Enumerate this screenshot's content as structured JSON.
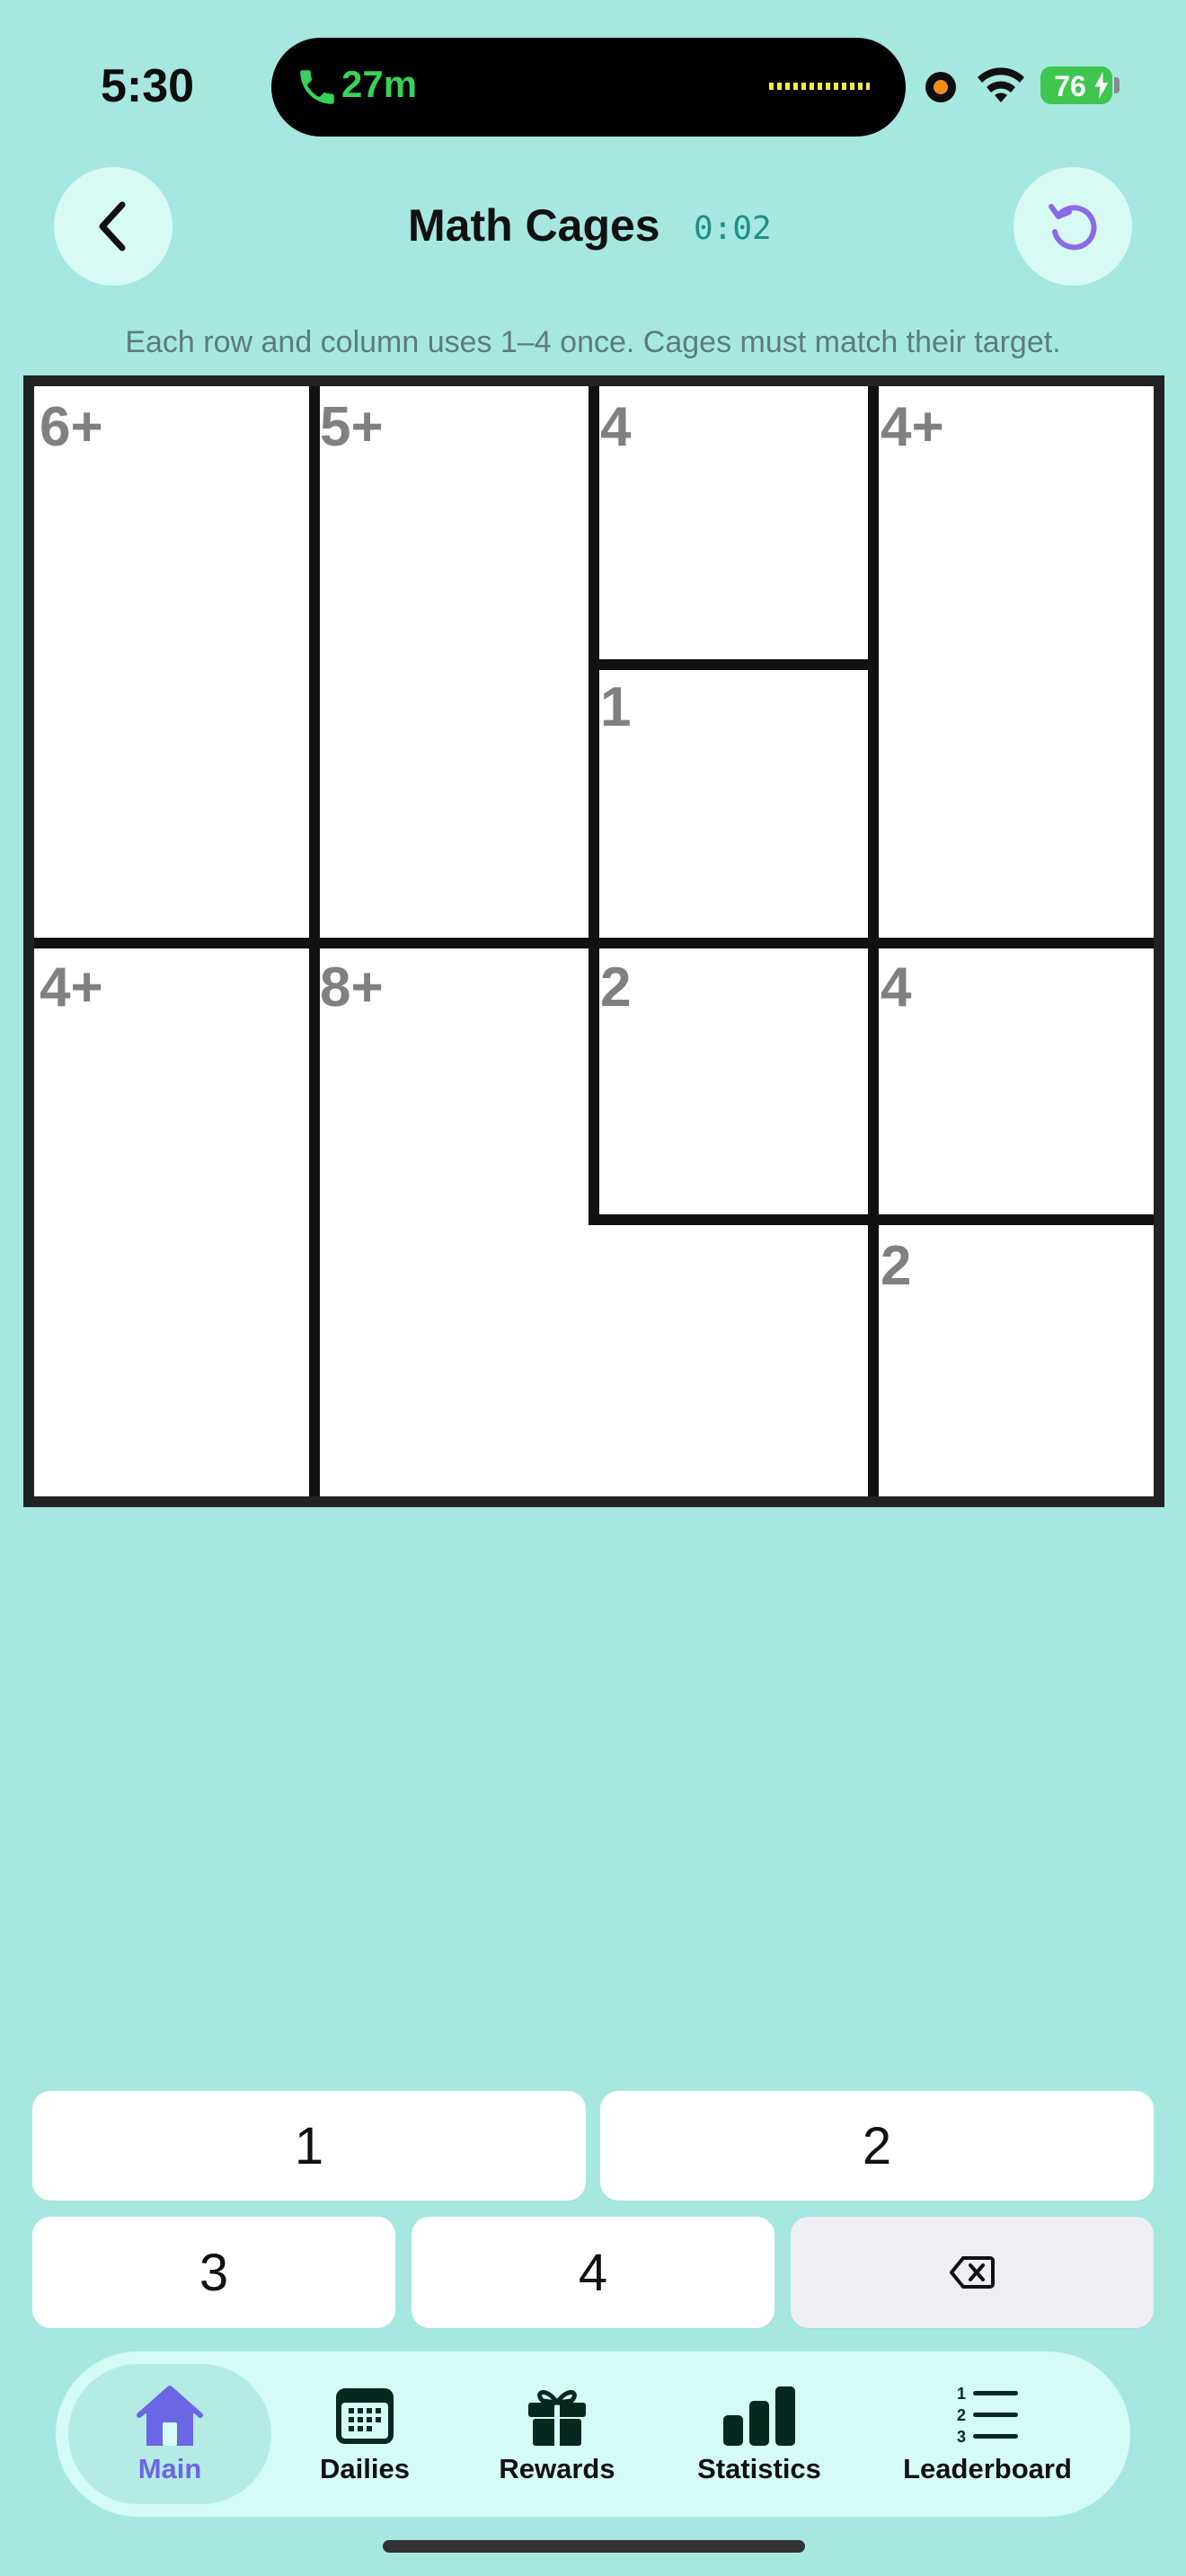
{
  "status_bar": {
    "time": "5:30",
    "call_duration": "27m",
    "battery": "76"
  },
  "header": {
    "title": "Math Cages",
    "timer": "0:02",
    "instructions": "Each row and column uses 1–4 once. Cages must match their target."
  },
  "board": {
    "size": 4,
    "clues": [
      "6+",
      "5+",
      "4",
      "4+",
      "1",
      "4+",
      "8+",
      "2",
      "4",
      "2"
    ]
  },
  "keypad": {
    "keys": [
      "1",
      "2",
      "3",
      "4"
    ]
  },
  "tabs": [
    {
      "label": "Main",
      "icon": "house-icon",
      "active": true
    },
    {
      "label": "Dailies",
      "icon": "calendar-icon"
    },
    {
      "label": "Rewards",
      "icon": "gift-icon"
    },
    {
      "label": "Statistics",
      "icon": "bar-chart-icon"
    },
    {
      "label": "Leaderboard",
      "icon": "numbered-list-icon"
    }
  ],
  "colors": {
    "background": "#a6e8df",
    "accent": "#6b66e4",
    "timer": "#1f8f85"
  }
}
